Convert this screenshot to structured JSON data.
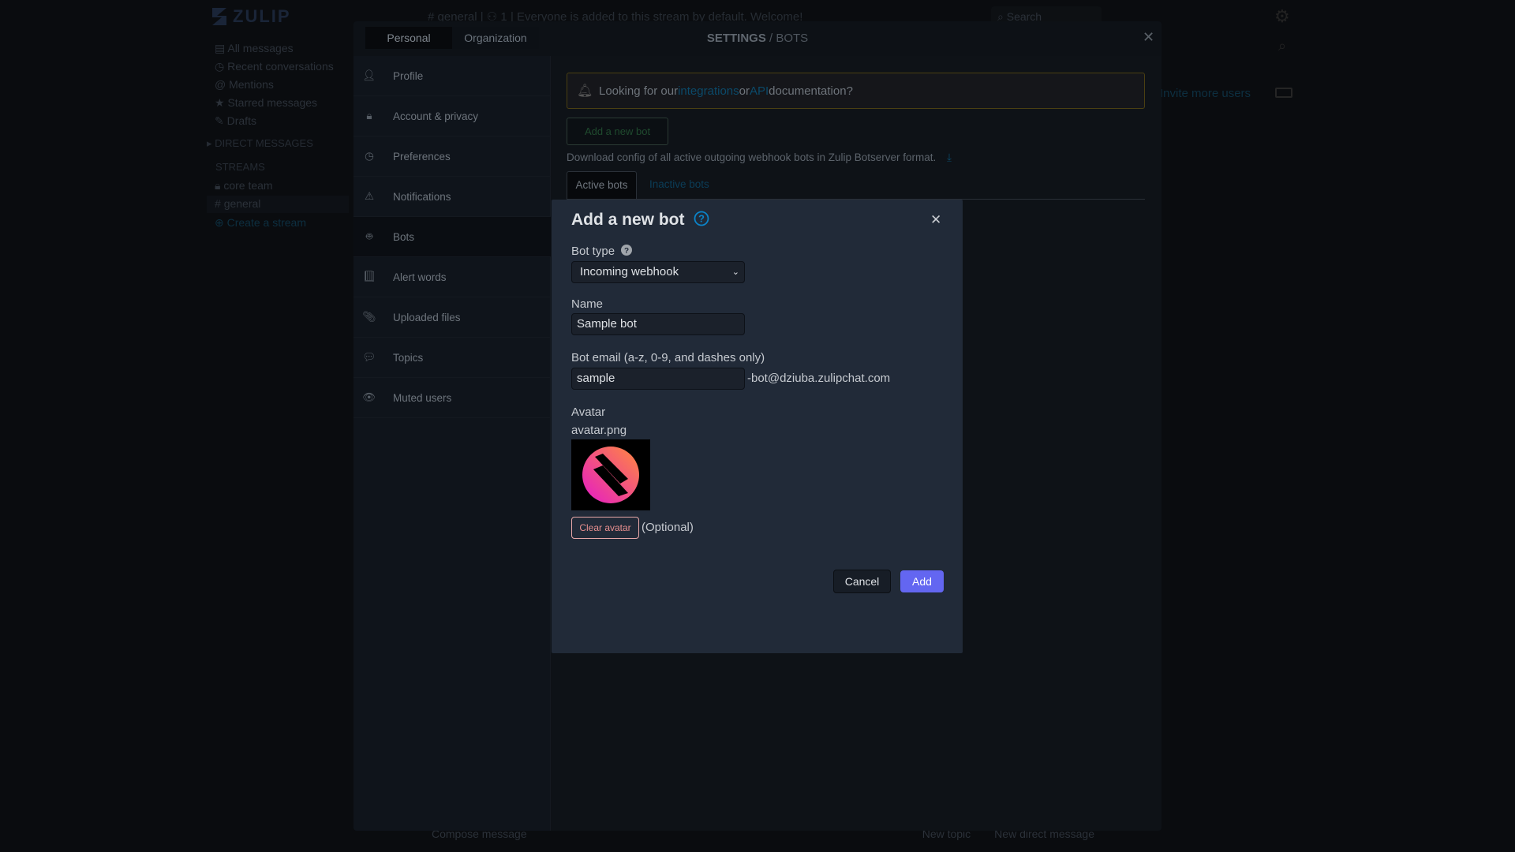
{
  "app": {
    "logo_text": "ZULIP",
    "header": {
      "stream": "general",
      "subscriber_count": "1",
      "description": "Everyone is added to this stream by default. Welcome!",
      "search_placeholder": "Search"
    },
    "left_sidebar": {
      "views": [
        {
          "label": "All messages",
          "icon": "all-messages-icon"
        },
        {
          "label": "Recent conversations",
          "icon": "clock-icon"
        },
        {
          "label": "Mentions",
          "icon": "at-icon"
        },
        {
          "label": "Starred messages",
          "icon": "star-icon"
        },
        {
          "label": "Drafts",
          "icon": "pencil-icon"
        }
      ],
      "direct_messages_heading": "DIRECT MESSAGES",
      "streams_heading": "STREAMS",
      "streams": [
        {
          "label": "core team",
          "icon": "lock-icon"
        },
        {
          "label": "general",
          "icon": "hash-icon"
        }
      ],
      "create_stream": "Create a stream"
    },
    "right_sidebar": {
      "invite_link": "Invite more users"
    },
    "compose": {
      "placeholder": "Compose message",
      "new_topic": "New topic",
      "new_dm": "New direct message"
    }
  },
  "settings": {
    "tabs": [
      {
        "label": "Personal",
        "active": true
      },
      {
        "label": "Organization",
        "active": false
      }
    ],
    "title_main": "SETTINGS",
    "title_sep": " / ",
    "title_sub": "BOTS",
    "sidebar": [
      {
        "label": "Profile",
        "icon": "user-icon"
      },
      {
        "label": "Account & privacy",
        "icon": "lock-icon"
      },
      {
        "label": "Preferences",
        "icon": "clock-icon"
      },
      {
        "label": "Notifications",
        "icon": "warning-icon"
      },
      {
        "label": "Bots",
        "icon": "robot-icon",
        "active": true
      },
      {
        "label": "Alert words",
        "icon": "book-icon"
      },
      {
        "label": "Uploaded files",
        "icon": "paperclip-icon"
      },
      {
        "label": "Topics",
        "icon": "chat-icon"
      },
      {
        "label": "Muted users",
        "icon": "eye-slash-icon"
      }
    ],
    "banner": {
      "pre": "Looking for our ",
      "link1": "integrations",
      "mid": " or ",
      "link2": "API",
      "post": " documentation?"
    },
    "add_bot_button": "Add a new bot",
    "download_text": "Download config of all active outgoing webhook bots in Zulip Botserver format.",
    "bot_tabs": {
      "active": "Active bots",
      "inactive": "Inactive bots"
    }
  },
  "modal": {
    "title": "Add a new bot",
    "bot_type_label": "Bot type",
    "bot_type_value": "Incoming webhook",
    "name_label": "Name",
    "name_value": "Sample bot",
    "email_label": "Bot email (a-z, 0-9, and dashes only)",
    "email_value": "sample",
    "email_suffix": "-bot@dziuba.zulipchat.com",
    "avatar_label": "Avatar",
    "avatar_filename": "avatar.png",
    "clear_avatar": "Clear avatar",
    "optional": "(Optional)",
    "cancel": "Cancel",
    "add": "Add"
  },
  "colors": {
    "primary_button": "#6366f1",
    "link": "#0b84c9",
    "danger": "#e88f8f"
  }
}
